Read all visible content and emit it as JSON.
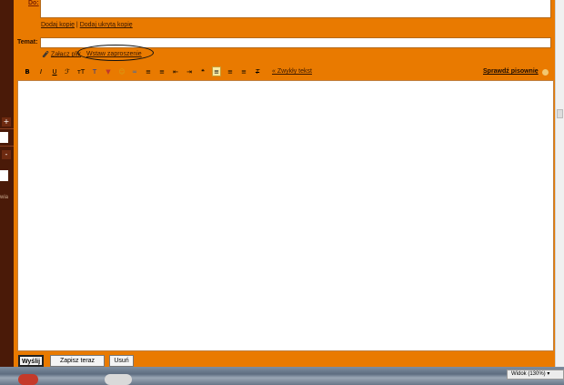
{
  "compose": {
    "to_label": "Do:",
    "copy_link": "Dodaj kopię",
    "separator": "|",
    "bcc_link": "Dodaj ukrytą kopię",
    "subject_label": "Temat:",
    "attach_link": "Załącz plik",
    "invite_link": "Wstaw zaproszenie"
  },
  "toolbar": {
    "items": [
      {
        "name": "bold",
        "glyph": "B"
      },
      {
        "name": "italic",
        "glyph": "I"
      },
      {
        "name": "underline",
        "glyph": "U"
      },
      {
        "name": "font",
        "glyph": "ℱ"
      },
      {
        "name": "font-size",
        "glyph": "ᴛT"
      },
      {
        "name": "text-color",
        "glyph": "T"
      },
      {
        "name": "highlight",
        "glyph": "▼"
      },
      {
        "name": "emoticon",
        "glyph": "☺"
      },
      {
        "name": "link",
        "glyph": "∞"
      },
      {
        "name": "numbered-list",
        "glyph": "≡"
      },
      {
        "name": "bulleted-list",
        "glyph": "≡"
      },
      {
        "name": "outdent",
        "glyph": "⇤"
      },
      {
        "name": "indent",
        "glyph": "⇥"
      },
      {
        "name": "quote",
        "glyph": "❝"
      },
      {
        "name": "align-left",
        "glyph": "≡"
      },
      {
        "name": "align-center",
        "glyph": "≡"
      },
      {
        "name": "align-right",
        "glyph": "≡"
      },
      {
        "name": "remove-format",
        "glyph": "T"
      }
    ],
    "plain_text_link": "« Zwykły tekst",
    "spellcheck_link": "Sprawdź pisownię"
  },
  "buttons": {
    "send": "Wyślij",
    "save_now": "Zapisz teraz",
    "delete": "Usuń"
  },
  "left_panel": {
    "plus": "+",
    "minus": "-",
    "text": "wia"
  },
  "status": {
    "zoom": "Widok (130%)"
  },
  "colors": {
    "frame_orange": "#e97a00",
    "left_panel": "#4a1a08"
  }
}
